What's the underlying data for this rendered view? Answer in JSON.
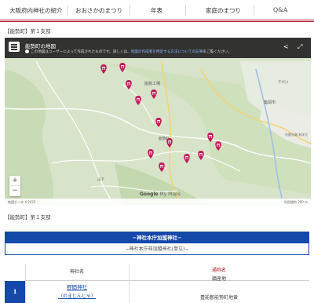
{
  "nav": {
    "items": [
      "大阪府内神社の紹介",
      "おおさかのまつり",
      "年表",
      "家庭のまつり",
      "Q&A"
    ]
  },
  "breadcrumb_top": "【能勢町】第１支部",
  "map": {
    "title": "能勢町の地図",
    "notice_pre": "この地図はユーザーによって作成されたものです。詳しくは、",
    "notice_link": "地図の作成者を特定する方法についての記事",
    "notice_post": "をご覧ください。",
    "share_icon": "share-icon",
    "expand_icon": "fullscreen-icon",
    "zoom_in": "+",
    "zoom_out": "−",
    "brand_google": "Google",
    "brand_mymaps": "My Maps",
    "footer_left": "地図データ ©2025",
    "footer_right": "利用規約  200 m",
    "labels": {
      "sasayama_top": "丹波篠山市",
      "hanno_road": "173",
      "kojin": "能勢町",
      "factory": "能勢工場",
      "kameoka": "亀岡市",
      "kameoka_uni": "京都先端\n科学大",
      "sennen": "千代川",
      "yamashita": "山下",
      "nose": "能勢町"
    },
    "pin_count": 13
  },
  "breadcrumb_bottom": "【能勢町】第１支部",
  "shrine_box": {
    "header": "−神社本庁加盟神社−",
    "sub": "−神社本庁非加盟神社(単立)−"
  },
  "table": {
    "headers": [
      "神社名",
      "通称名",
      "鎮座地"
    ],
    "rows": [
      {
        "num": "1",
        "name": "野間神社",
        "reading": "（のまじんじゃ）",
        "alias": "",
        "address": "豊能郡能勢町地黄"
      }
    ]
  },
  "colors": {
    "accent_red": "#b21d2b",
    "brand_blue": "#1548a9",
    "pin": "#c2185b"
  }
}
